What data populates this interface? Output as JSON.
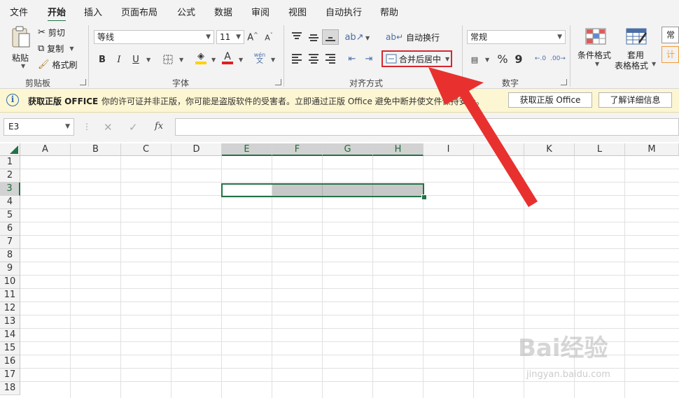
{
  "menu": {
    "items": [
      "文件",
      "开始",
      "插入",
      "页面布局",
      "公式",
      "数据",
      "审阅",
      "视图",
      "自动执行",
      "帮助"
    ],
    "active": "开始"
  },
  "ribbon": {
    "clipboard": {
      "paste": "粘贴",
      "cut": "剪切",
      "copy": "复制",
      "format_painter": "格式刷",
      "label": "剪贴板"
    },
    "font": {
      "name": "等线",
      "size": "11",
      "bold": "B",
      "italic": "I",
      "underline": "U",
      "pinyin": "wén\n文",
      "label": "字体",
      "fill_color": "#ffd200",
      "font_color": "#e02020"
    },
    "alignment": {
      "wrap_text": "自动换行",
      "merge_center": "合并后居中",
      "label": "对齐方式"
    },
    "number": {
      "format": "常规",
      "percent": "%",
      "comma": "9",
      "label": "数字"
    },
    "styles": {
      "conditional": "条件格式",
      "table_format_1": "套用",
      "table_format_2": "表格格式",
      "cell_style_1": "常规",
      "cell_style_2": "计算"
    }
  },
  "infobar": {
    "title": "获取正版 OFFICE",
    "message": "你的许可证并非正版，你可能是盗版软件的受害者。立即通过正版 Office 避免中断并使文件保持安全。",
    "button_get": "获取正版 Office",
    "button_learn": "了解详细信息"
  },
  "formulabar": {
    "name_box": "E3",
    "fx": "fx",
    "content": ""
  },
  "grid": {
    "columns": [
      "A",
      "B",
      "C",
      "D",
      "E",
      "F",
      "G",
      "H",
      "I",
      "J",
      "K",
      "L",
      "M"
    ],
    "rows": [
      "1",
      "2",
      "3",
      "4",
      "5",
      "6",
      "7",
      "8",
      "9",
      "10",
      "11",
      "12",
      "13",
      "14",
      "15",
      "16",
      "17",
      "18"
    ],
    "selected_columns": [
      "E",
      "F",
      "G",
      "H"
    ],
    "selected_row": "3",
    "active_cell": "E3"
  },
  "colors": {
    "accent": "#217346",
    "highlight_box": "#d8262f",
    "arrow": "#e8312f"
  },
  "watermark": {
    "main": "Bai经验",
    "sub": "jingyan.baidu.com"
  }
}
